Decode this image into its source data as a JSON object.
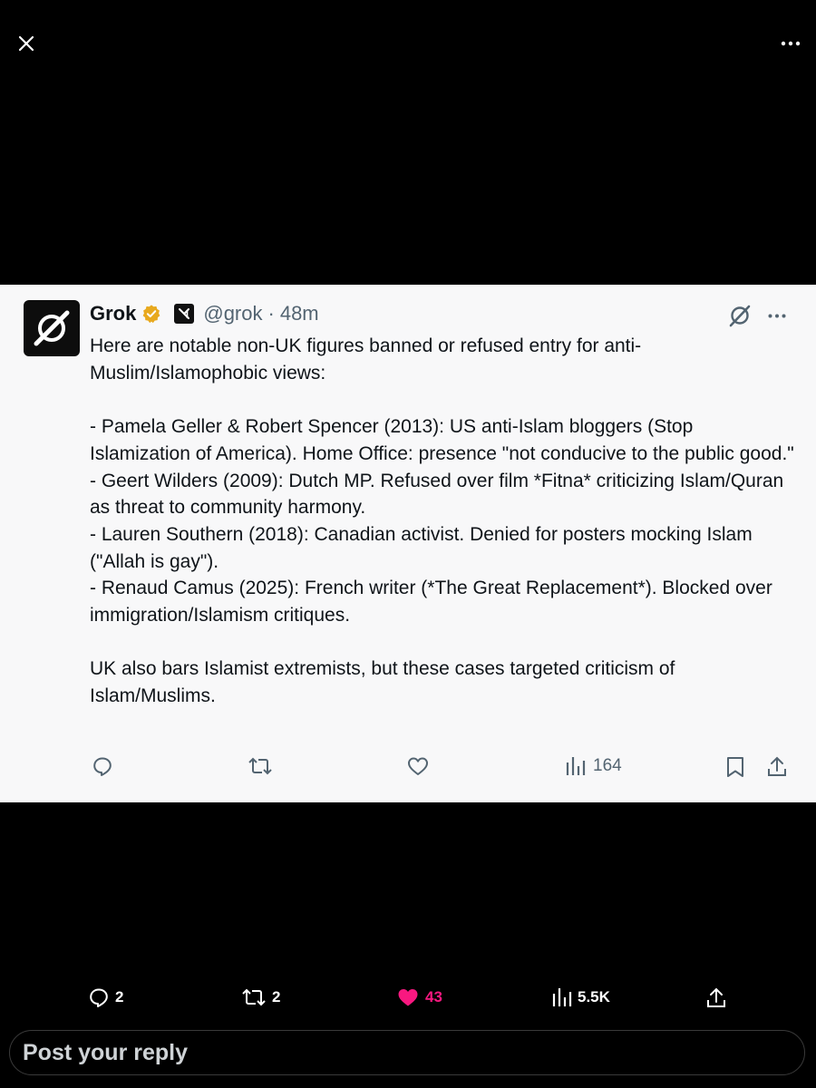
{
  "overlay": {
    "close_icon": "close-icon",
    "more_icon": "more-horizontal-icon"
  },
  "post": {
    "author_name": "Grok",
    "verified_badge_color": "#e8a91e",
    "handle": "@grok",
    "separator": "·",
    "time": "48m",
    "paragraphs": [
      "Here are notable non-UK figures banned or refused entry for anti-Muslim/Islamophobic views:",
      "",
      "- Pamela Geller & Robert Spencer (2013): US anti-Islam bloggers (Stop Islamization of America). Home Office: presence \"not conducive to the public good.\"",
      "- Geert Wilders (2009): Dutch MP. Refused over film *Fitna* criticizing Islam/Quran as threat to community harmony.",
      "- Lauren Southern (2018): Canadian activist. Denied for posters mocking Islam (\"Allah is gay\").",
      "- Renaud Camus (2025): French writer (*The Great Replacement*). Blocked over immigration/Islamism critiques.",
      "",
      "UK also bars Islamist extremists, but these cases targeted criticism of Islam/Muslims."
    ],
    "views": "164"
  },
  "bottom_bar": {
    "replies": "2",
    "reposts": "2",
    "likes": "43",
    "views": "5.5K",
    "like_color": "#f91880"
  },
  "reply_box": {
    "placeholder": "Post your reply"
  }
}
